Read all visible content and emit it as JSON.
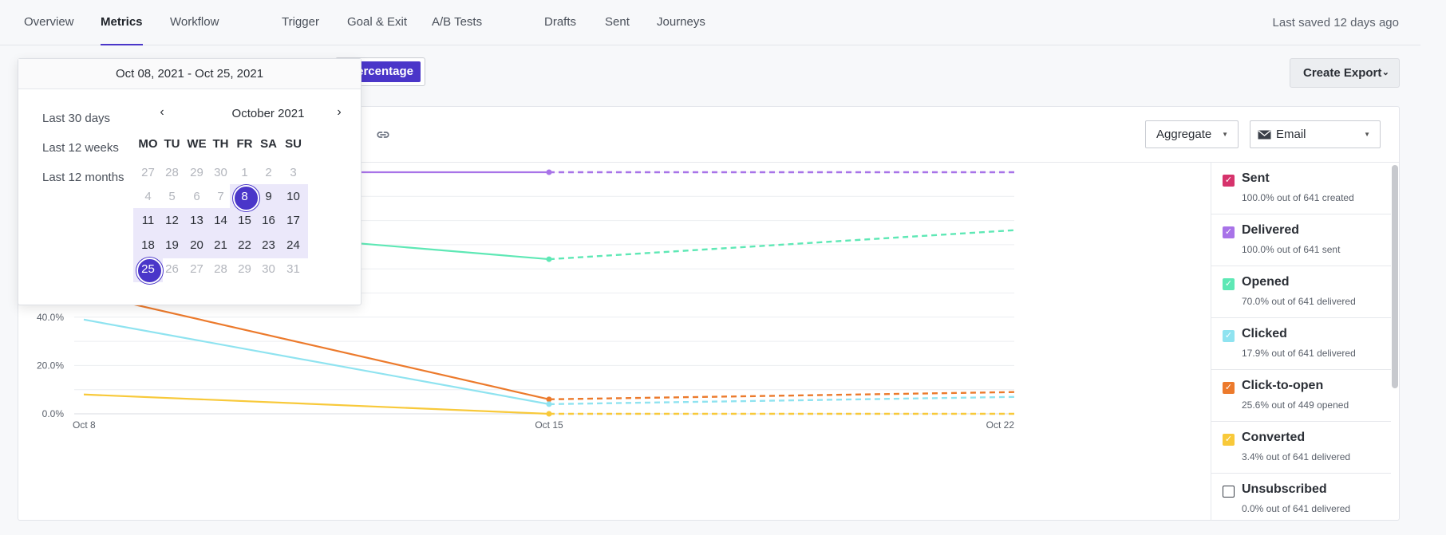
{
  "nav": {
    "tabs": [
      {
        "label": "Overview",
        "active": false
      },
      {
        "label": "Metrics",
        "active": true
      },
      {
        "label": "Workflow",
        "active": false
      },
      {
        "label": "Trigger",
        "active": false
      },
      {
        "label": "Goal & Exit",
        "active": false
      },
      {
        "label": "A/B Tests",
        "active": false
      },
      {
        "label": "Drafts",
        "active": false
      },
      {
        "label": "Sent",
        "active": false
      },
      {
        "label": "Journeys",
        "active": false
      }
    ],
    "last_saved": "Last saved 12 days ago"
  },
  "toolbar": {
    "percentage_label": "Percentage",
    "export_label": "Create Export",
    "aggregate_label": "Aggregate",
    "channel_label": "Email"
  },
  "date_picker": {
    "range_text": "Oct 08, 2021 - Oct 25, 2021",
    "presets": [
      "Last 30 days",
      "Last 12 weeks",
      "Last 12 months"
    ],
    "month_title": "October 2021",
    "weekdays": [
      "MO",
      "TU",
      "WE",
      "TH",
      "FR",
      "SA",
      "SU"
    ],
    "weeks": [
      [
        27,
        28,
        29,
        30,
        1,
        2,
        3
      ],
      [
        4,
        5,
        6,
        7,
        8,
        9,
        10
      ],
      [
        11,
        12,
        13,
        14,
        15,
        16,
        17
      ],
      [
        18,
        19,
        20,
        21,
        22,
        23,
        24
      ],
      [
        25,
        26,
        27,
        28,
        29,
        30,
        31
      ]
    ],
    "range_start": 8,
    "range_end": 25
  },
  "legend": [
    {
      "label": "Sent",
      "sub": "100.0% out of 641 created",
      "color": "#d6336c",
      "checked": true
    },
    {
      "label": "Delivered",
      "sub": "100.0% out of 641 sent",
      "color": "#a873e8",
      "checked": true
    },
    {
      "label": "Opened",
      "sub": "70.0% out of 641 delivered",
      "color": "#5ee8b5",
      "checked": true
    },
    {
      "label": "Clicked",
      "sub": "17.9% out of 641 delivered",
      "color": "#8fe3f0",
      "checked": true
    },
    {
      "label": "Click-to-open",
      "sub": "25.6% out of 449 opened",
      "color": "#ec7a2c",
      "checked": true
    },
    {
      "label": "Converted",
      "sub": "3.4% out of 641 delivered",
      "color": "#f8c93a",
      "checked": true
    },
    {
      "label": "Unsubscribed",
      "sub": "0.0% out of 641 delivered",
      "color": "#3a3f48",
      "checked": false
    }
  ],
  "chart_data": {
    "type": "line",
    "x": [
      "Oct 8",
      "Oct 15",
      "Oct 22"
    ],
    "ytick_labels": [
      "0.0%",
      "20.0%",
      "40.0%"
    ],
    "ylim": [
      0,
      100
    ],
    "grid": true,
    "series": [
      {
        "name": "Delivered",
        "color": "#a873e8",
        "values": [
          100,
          100,
          100
        ],
        "dashed_from_index": 1
      },
      {
        "name": "Opened",
        "color": "#5ee8b5",
        "values": [
          80,
          64,
          76
        ],
        "dashed_from_index": 1
      },
      {
        "name": "Click-to-open",
        "color": "#ec7a2c",
        "values": [
          50,
          6,
          9
        ],
        "dashed_from_index": 1
      },
      {
        "name": "Clicked",
        "color": "#8fe3f0",
        "values": [
          39,
          4,
          7
        ],
        "dashed_from_index": 1
      },
      {
        "name": "Converted",
        "color": "#f8c93a",
        "values": [
          8,
          0,
          0
        ],
        "dashed_from_index": 1
      }
    ]
  }
}
